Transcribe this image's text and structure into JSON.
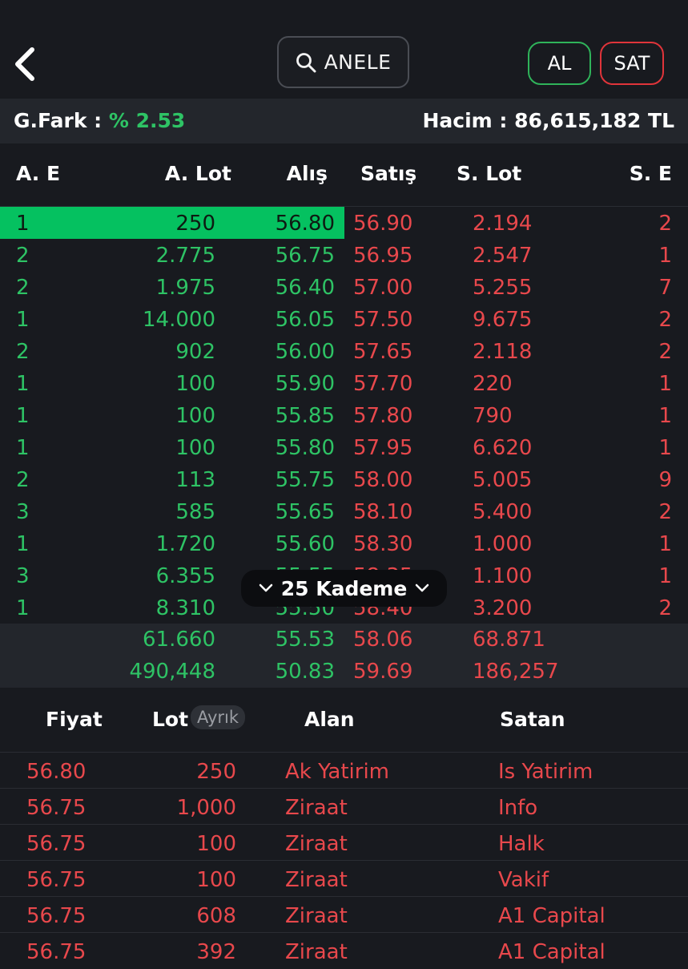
{
  "header": {
    "back_icon": "chevron-left-icon",
    "search_icon": "search-icon",
    "symbol": "ANELE",
    "buy_label": "AL",
    "sell_label": "SAT"
  },
  "info": {
    "gfark_label": "G.Fark :",
    "gfark_value": "% 2.53",
    "hacim_label": "Hacim :",
    "hacim_value": "86,615,182 TL"
  },
  "orderbook": {
    "columns": [
      "A. E",
      "A. Lot",
      "Alış",
      "Satış",
      "S. Lot",
      "S. E"
    ],
    "rows": [
      {
        "ae": "1",
        "alot": "250",
        "alis": "56.80",
        "satis": "56.90",
        "slot": "2.194",
        "se": "2"
      },
      {
        "ae": "2",
        "alot": "2.775",
        "alis": "56.75",
        "satis": "56.95",
        "slot": "2.547",
        "se": "1"
      },
      {
        "ae": "2",
        "alot": "1.975",
        "alis": "56.40",
        "satis": "57.00",
        "slot": "5.255",
        "se": "7"
      },
      {
        "ae": "1",
        "alot": "14.000",
        "alis": "56.05",
        "satis": "57.50",
        "slot": "9.675",
        "se": "2"
      },
      {
        "ae": "2",
        "alot": "902",
        "alis": "56.00",
        "satis": "57.65",
        "slot": "2.118",
        "se": "2"
      },
      {
        "ae": "1",
        "alot": "100",
        "alis": "55.90",
        "satis": "57.70",
        "slot": "220",
        "se": "1"
      },
      {
        "ae": "1",
        "alot": "100",
        "alis": "55.85",
        "satis": "57.80",
        "slot": "790",
        "se": "1"
      },
      {
        "ae": "1",
        "alot": "100",
        "alis": "55.80",
        "satis": "57.95",
        "slot": "6.620",
        "se": "1"
      },
      {
        "ae": "2",
        "alot": "113",
        "alis": "55.75",
        "satis": "58.00",
        "slot": "5.005",
        "se": "9"
      },
      {
        "ae": "3",
        "alot": "585",
        "alis": "55.65",
        "satis": "58.10",
        "slot": "5.400",
        "se": "2"
      },
      {
        "ae": "1",
        "alot": "1.720",
        "alis": "55.60",
        "satis": "58.30",
        "slot": "1.000",
        "se": "1"
      },
      {
        "ae": "3",
        "alot": "6.355",
        "alis": "55.55",
        "satis": "58.35",
        "slot": "1.100",
        "se": "1"
      },
      {
        "ae": "1",
        "alot": "8.310",
        "alis": "55.50",
        "satis": "58.40",
        "slot": "3.200",
        "se": "2"
      }
    ],
    "summary": [
      {
        "alot": "61.660",
        "alis": "55.53",
        "satis": "58.06",
        "slot": "68.871"
      },
      {
        "alot": "490,448",
        "alis": "50.83",
        "satis": "59.69",
        "slot": "186,257"
      }
    ],
    "kademe_label": "25 Kademe"
  },
  "trades": {
    "columns": {
      "fiyat": "Fiyat",
      "lot": "Lot",
      "ayrik": "Ayrık",
      "alan": "Alan",
      "satan": "Satan"
    },
    "rows": [
      {
        "fiyat": "56.80",
        "lot": "250",
        "alan": "Ak Yatirim",
        "satan": "Is Yatirim"
      },
      {
        "fiyat": "56.75",
        "lot": "1,000",
        "alan": "Ziraat",
        "satan": "Info"
      },
      {
        "fiyat": "56.75",
        "lot": "100",
        "alan": "Ziraat",
        "satan": "Halk"
      },
      {
        "fiyat": "56.75",
        "lot": "100",
        "alan": "Ziraat",
        "satan": "Vakif"
      },
      {
        "fiyat": "56.75",
        "lot": "608",
        "alan": "Ziraat",
        "satan": "A1 Capital"
      },
      {
        "fiyat": "56.75",
        "lot": "392",
        "alan": "Ziraat",
        "satan": "A1 Capital"
      }
    ]
  },
  "colors": {
    "background": "#181a1f",
    "bid_green": "#2ec365",
    "ask_red": "#e8484c",
    "highlight": "#05c160"
  }
}
